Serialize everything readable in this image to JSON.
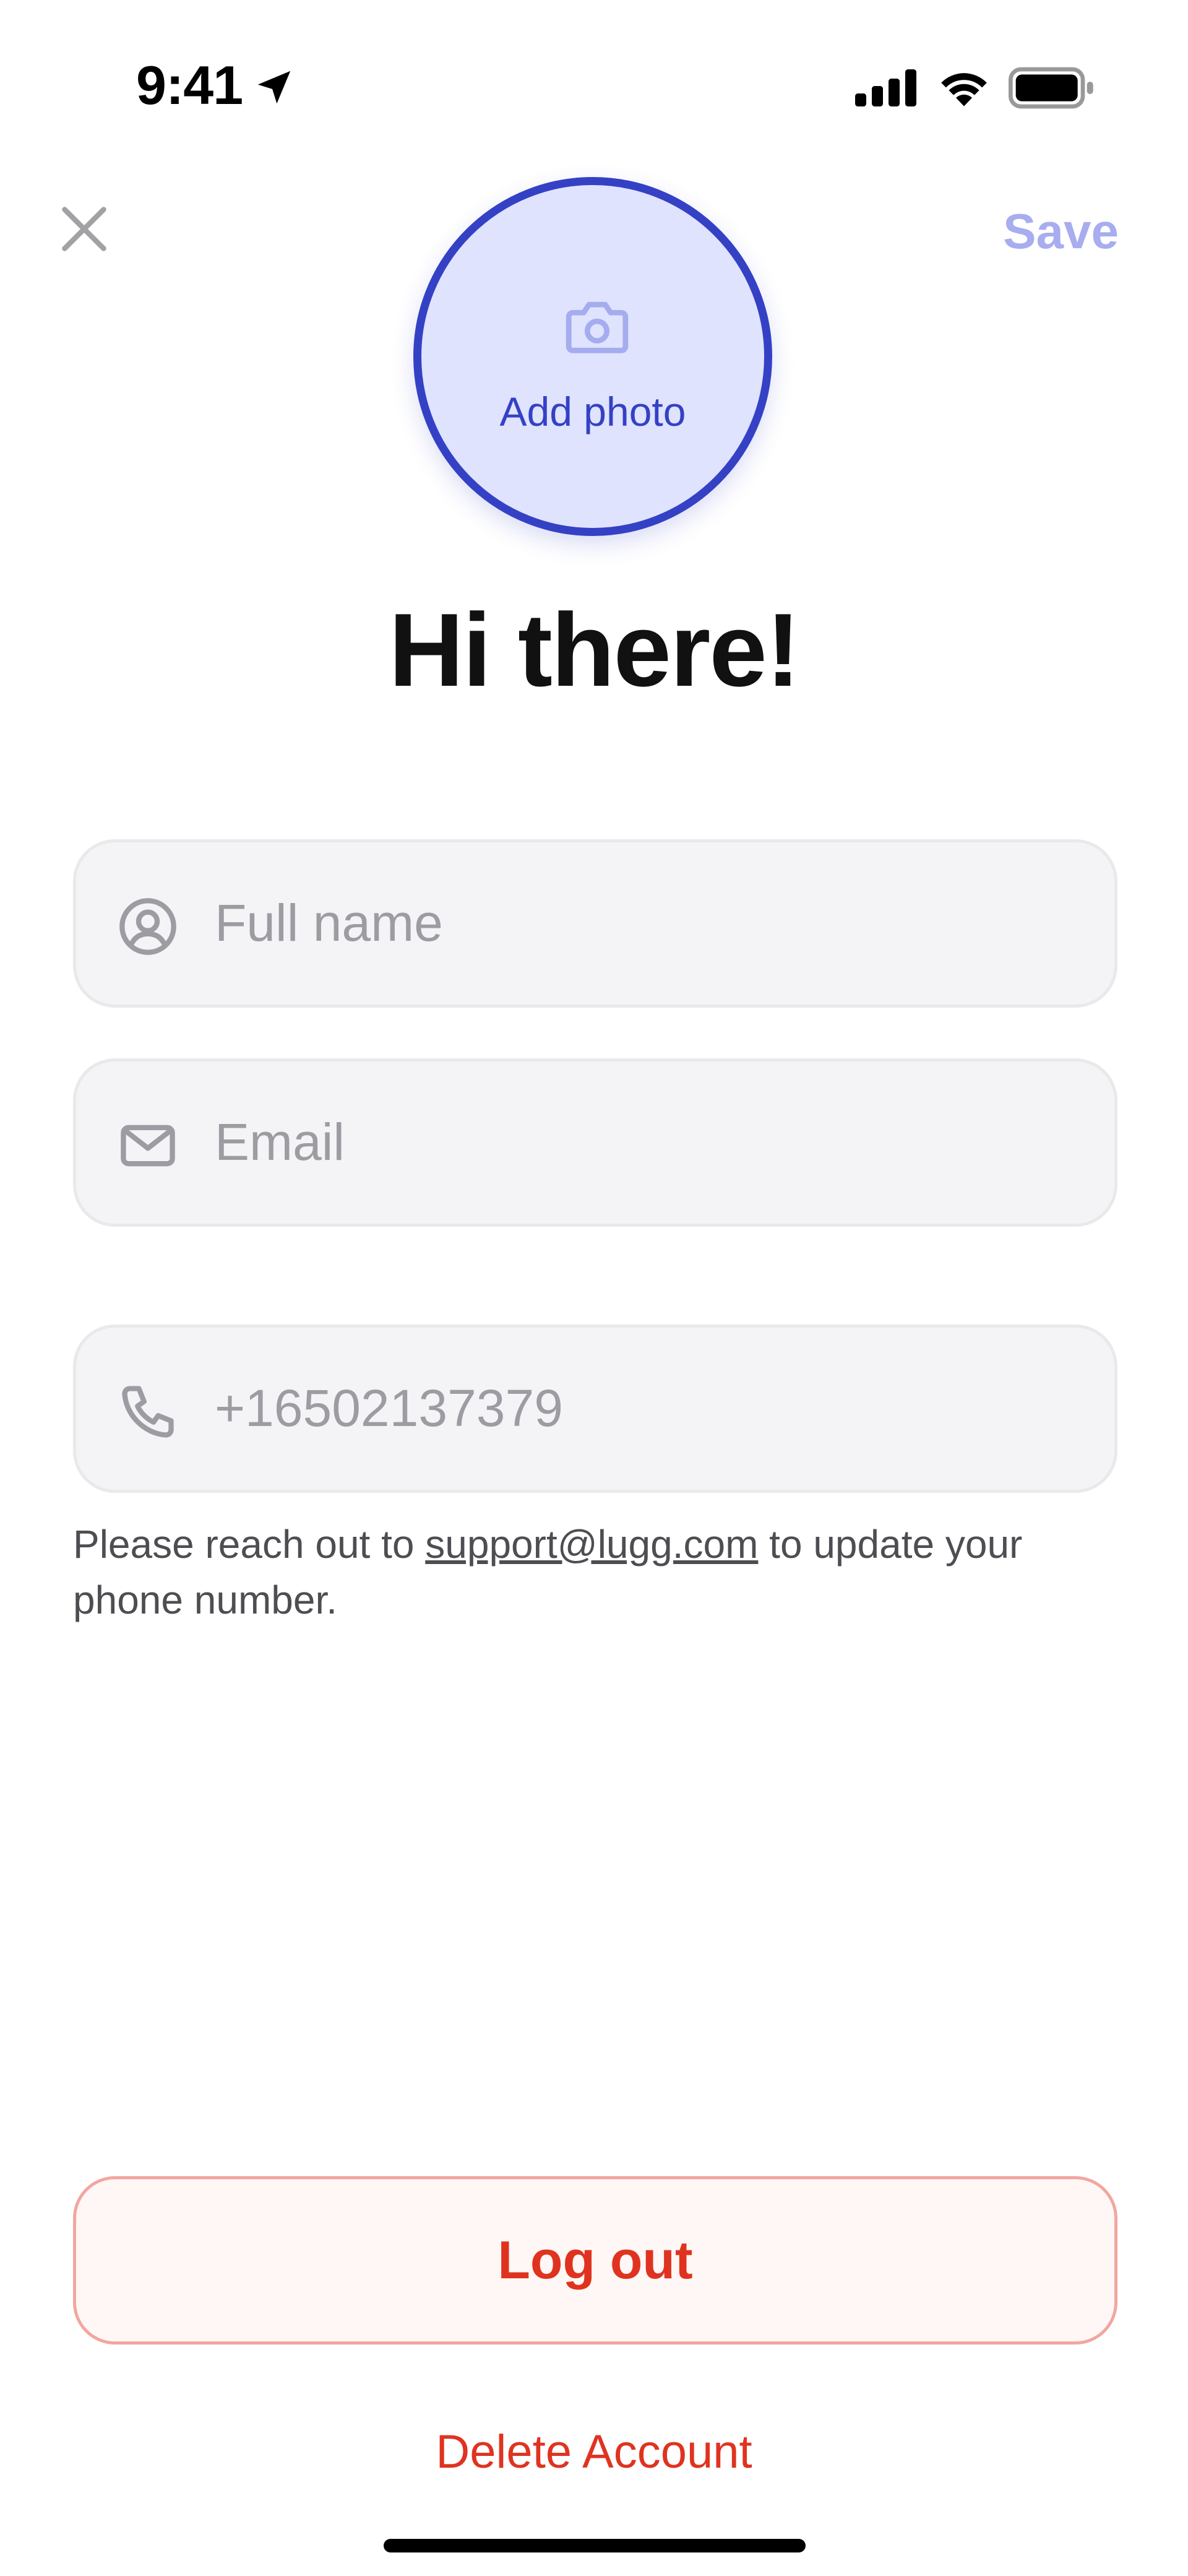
{
  "status_bar": {
    "time": "9:41",
    "icons": [
      "location-arrow-icon",
      "cellular-signal-icon",
      "wifi-icon",
      "battery-icon"
    ]
  },
  "nav": {
    "close_icon": "close-icon",
    "save_label": "Save"
  },
  "avatar": {
    "icon": "camera-icon",
    "label": "Add photo"
  },
  "title": "Hi there!",
  "fields": {
    "full_name": {
      "icon": "user-circle-icon",
      "placeholder": "Full name",
      "value": ""
    },
    "email": {
      "icon": "envelope-icon",
      "placeholder": "Email",
      "value": ""
    },
    "phone": {
      "icon": "phone-icon",
      "value": "+16502137379"
    }
  },
  "phone_helper": {
    "prefix": "Please reach out to ",
    "link": "support@lugg.com",
    "suffix": " to update your phone number."
  },
  "actions": {
    "logout_label": "Log out",
    "delete_label": "Delete Account"
  },
  "colors": {
    "accent": "#3441c5",
    "accent_light": "#dfe3fd",
    "save_disabled": "#a7adef",
    "danger": "#df3320",
    "field_bg": "#f4f4f6",
    "placeholder": "#9c9ca2"
  }
}
